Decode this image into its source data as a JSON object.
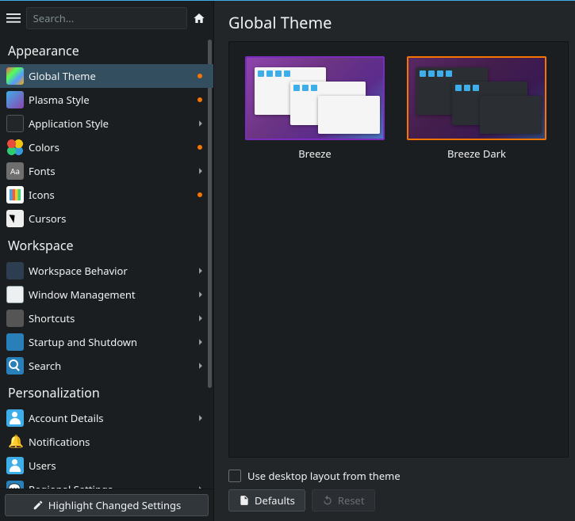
{
  "search": {
    "placeholder": "Search..."
  },
  "sidebar": {
    "sections": [
      {
        "title": "Appearance",
        "items": [
          {
            "label": "Global Theme",
            "icon": "global",
            "selected": true,
            "dot": true
          },
          {
            "label": "Plasma Style",
            "icon": "plasma",
            "dot": true
          },
          {
            "label": "Application Style",
            "icon": "appstyle",
            "chevron": true
          },
          {
            "label": "Colors",
            "icon": "colors",
            "dot": true
          },
          {
            "label": "Fonts",
            "icon": "fonts",
            "chevron": true
          },
          {
            "label": "Icons",
            "icon": "icons",
            "dot": true
          },
          {
            "label": "Cursors",
            "icon": "cursors"
          }
        ]
      },
      {
        "title": "Workspace",
        "items": [
          {
            "label": "Workspace Behavior",
            "icon": "workbeh",
            "chevron": true
          },
          {
            "label": "Window Management",
            "icon": "winmgmt",
            "chevron": true
          },
          {
            "label": "Shortcuts",
            "icon": "shortcuts",
            "chevron": true
          },
          {
            "label": "Startup and Shutdown",
            "icon": "startup",
            "chevron": true
          },
          {
            "label": "Search",
            "icon": "search",
            "chevron": true
          }
        ]
      },
      {
        "title": "Personalization",
        "items": [
          {
            "label": "Account Details",
            "icon": "account",
            "chevron": true
          },
          {
            "label": "Notifications",
            "icon": "notif"
          },
          {
            "label": "Users",
            "icon": "users"
          },
          {
            "label": "Regional Settings",
            "icon": "regional",
            "chevron": true
          }
        ]
      }
    ]
  },
  "footer": {
    "highlight": "Highlight Changed Settings"
  },
  "main": {
    "title": "Global Theme",
    "themes": [
      {
        "name": "Breeze",
        "dark": false,
        "selected": false
      },
      {
        "name": "Breeze Dark",
        "dark": true,
        "selected": true
      }
    ],
    "use_layout_label": "Use desktop layout from theme",
    "use_layout_checked": false,
    "defaults_label": "Defaults",
    "reset_label": "Reset"
  }
}
